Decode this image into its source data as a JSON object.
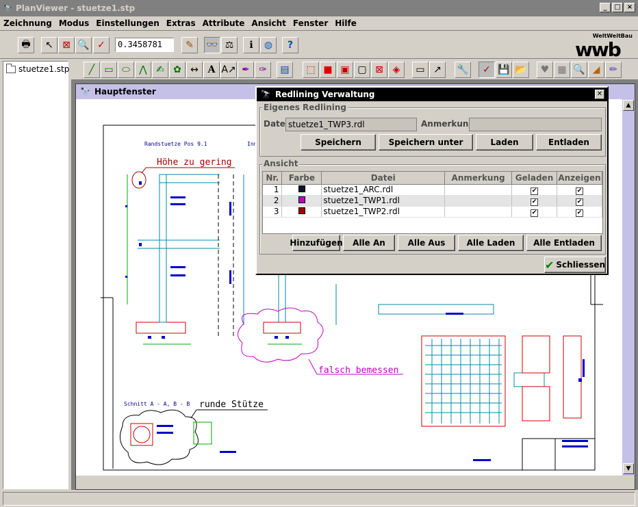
{
  "window": {
    "title": "PlanViewer - stuetze1.stp"
  },
  "menu": [
    {
      "label": "Zeichnung",
      "ul": "Z",
      "rest": "eichnung"
    },
    {
      "label": "Modus",
      "ul": "M",
      "rest": "odus"
    },
    {
      "label": "Einstellungen",
      "ul": "E",
      "rest": "instellungen"
    },
    {
      "label": "Extras",
      "ul": "x",
      "pre": "E",
      "rest": "tras"
    },
    {
      "label": "Attribute",
      "ul": "A",
      "rest": "ttribute"
    },
    {
      "label": "Ansicht",
      "ul": "A",
      "rest": "nsicht"
    },
    {
      "label": "Fenster",
      "ul": "F",
      "rest": "enster"
    },
    {
      "label": "Hilfe",
      "ul": "H",
      "rest": "ilfe"
    }
  ],
  "toolbar": {
    "zoom_value": "0.3458781"
  },
  "logo": {
    "small": "WeltWeitBau",
    "big": "wwb"
  },
  "tree": {
    "item": "stuetze1.stp"
  },
  "inner_window": {
    "title": "Hauptfenster"
  },
  "drawing": {
    "labels": [
      "Randstuetze Pos 9.1",
      "Inn",
      "Höhe zu gering",
      "falsch bemessen",
      "Schnitt A - A, B - B",
      "runde Stütze"
    ]
  },
  "dialog": {
    "title": "Redlining Verwaltung",
    "own_group": "Eigenes Redlining",
    "datei_label": "Datei",
    "datei_value": "stuetze1_TWP3.rdl",
    "anmerkung_label": "Anmerkung",
    "anmerkung_value": "",
    "buttons_top": [
      "Speichern",
      "Speichern unter",
      "Laden",
      "Entladen"
    ],
    "view_group": "Ansicht",
    "columns": [
      "Nr.",
      "Farbe",
      "Datei",
      "Anmerkung",
      "Geladen",
      "Anzeigen"
    ],
    "rows": [
      {
        "nr": "1",
        "color": "#101030",
        "datei": "stuetze1_ARC.rdl",
        "anmerkung": "",
        "geladen": "✔",
        "anzeigen": "✔"
      },
      {
        "nr": "2",
        "color": "#c000c0",
        "datei": "stuetze1_TWP1.rdl",
        "anmerkung": "",
        "geladen": "✔",
        "anzeigen": "✔"
      },
      {
        "nr": "3",
        "color": "#a00000",
        "datei": "stuetze1_TWP2.rdl",
        "anmerkung": "",
        "geladen": "✔",
        "anzeigen": "✔"
      }
    ],
    "buttons_bottom": [
      "Hinzufügen",
      "Alle An",
      "Alle Aus",
      "Alle Laden",
      "Alle Entladen"
    ],
    "close_button": "Schliessen"
  }
}
